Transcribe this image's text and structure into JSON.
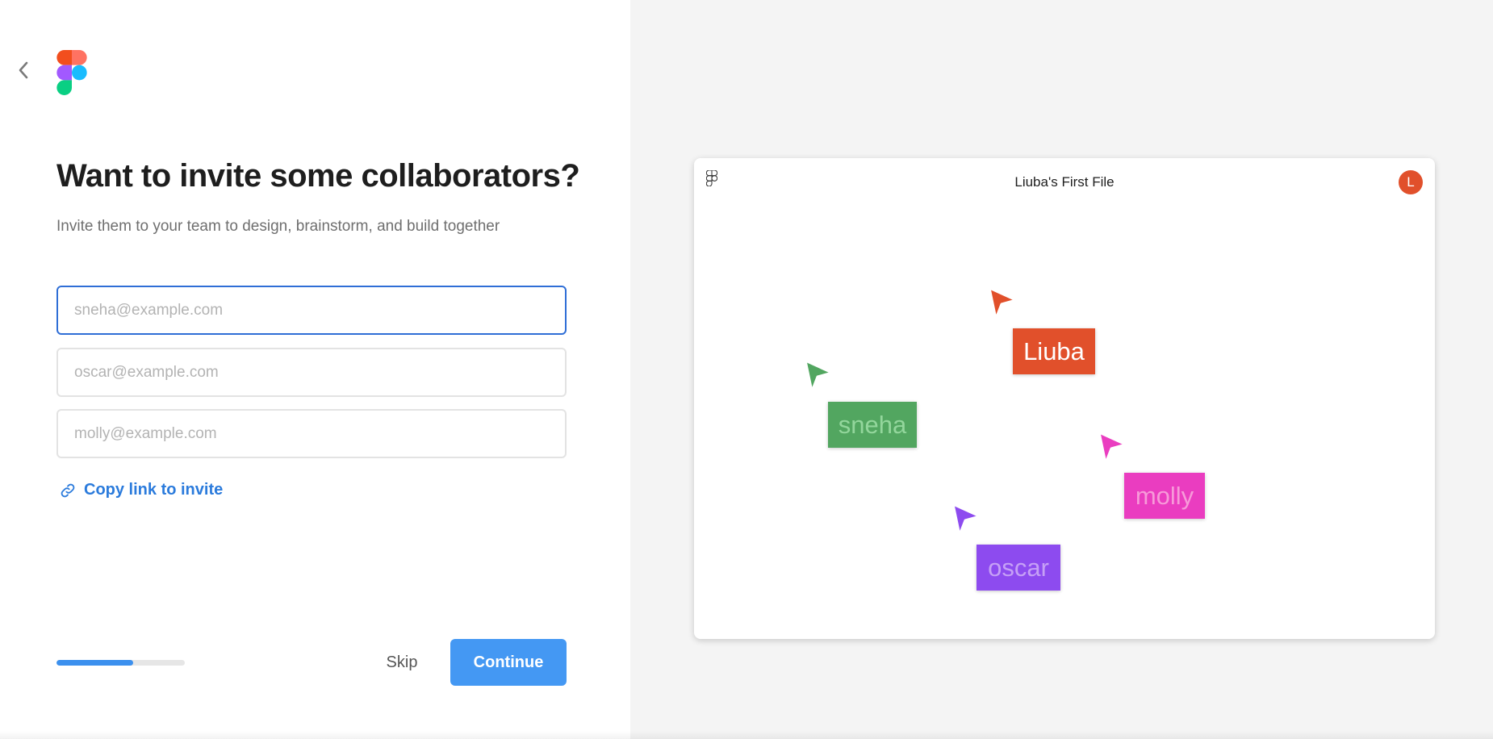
{
  "header": {
    "back_icon": "chevron-left-icon",
    "logo_icon": "figma-logo"
  },
  "main": {
    "title": "Want to invite some collaborators?",
    "subtitle": "Invite them to your team to design, brainstorm, and build together",
    "inputs": [
      {
        "placeholder": "sneha@example.com",
        "value": ""
      },
      {
        "placeholder": "oscar@example.com",
        "value": ""
      },
      {
        "placeholder": "molly@example.com",
        "value": ""
      }
    ],
    "copy_link": {
      "icon": "link-icon",
      "label": "Copy link to invite"
    },
    "progress": 0.6,
    "skip_label": "Skip",
    "continue_label": "Continue"
  },
  "preview": {
    "file_title": "Liuba's First File",
    "avatar_initial": "L",
    "cursors": [
      {
        "name": "Liuba",
        "color": "#e1502b",
        "text_color": "#ffffff"
      },
      {
        "name": "sneha",
        "color": "#52a660",
        "text_color": "#93d69c"
      },
      {
        "name": "molly",
        "color": "#ea3dc0",
        "text_color": "#f79ad9"
      },
      {
        "name": "oscar",
        "color": "#8d4bef",
        "text_color": "#c6a0f6"
      }
    ]
  },
  "colors": {
    "accent": "#4498f3",
    "link": "#2b7bdc",
    "focus": "#2f6ed6"
  }
}
